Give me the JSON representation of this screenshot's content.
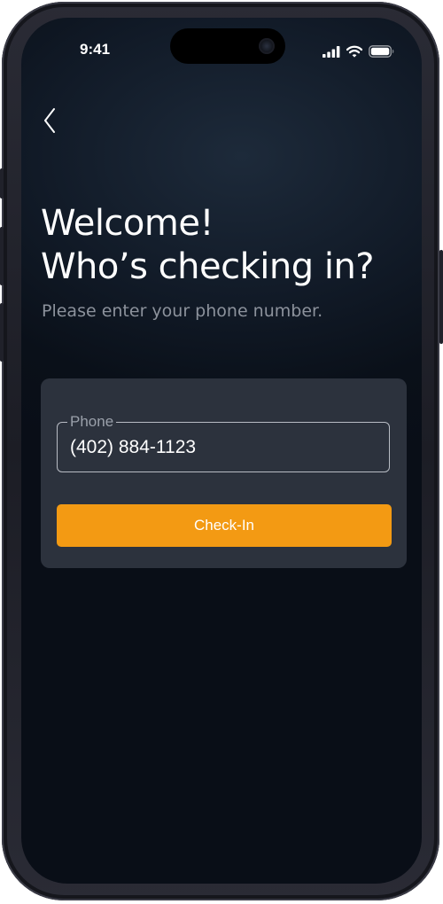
{
  "status_bar": {
    "time": "9:41",
    "icons": [
      "cellular-signal-icon",
      "wifi-icon",
      "battery-icon"
    ]
  },
  "navigation": {
    "back_icon": "chevron-left-icon"
  },
  "header": {
    "title_line1": "Welcome!",
    "title_line2": "Who’s checking in?",
    "subtitle": "Please enter your phone number."
  },
  "form": {
    "phone_label": "Phone",
    "phone_value": "(402) 884-1123",
    "checkin_label": "Check-In"
  },
  "colors": {
    "accent": "#f39a13",
    "card_background": "#2c323d",
    "screen_background": "#0a1019",
    "subtitle_text": "#8c929c"
  }
}
